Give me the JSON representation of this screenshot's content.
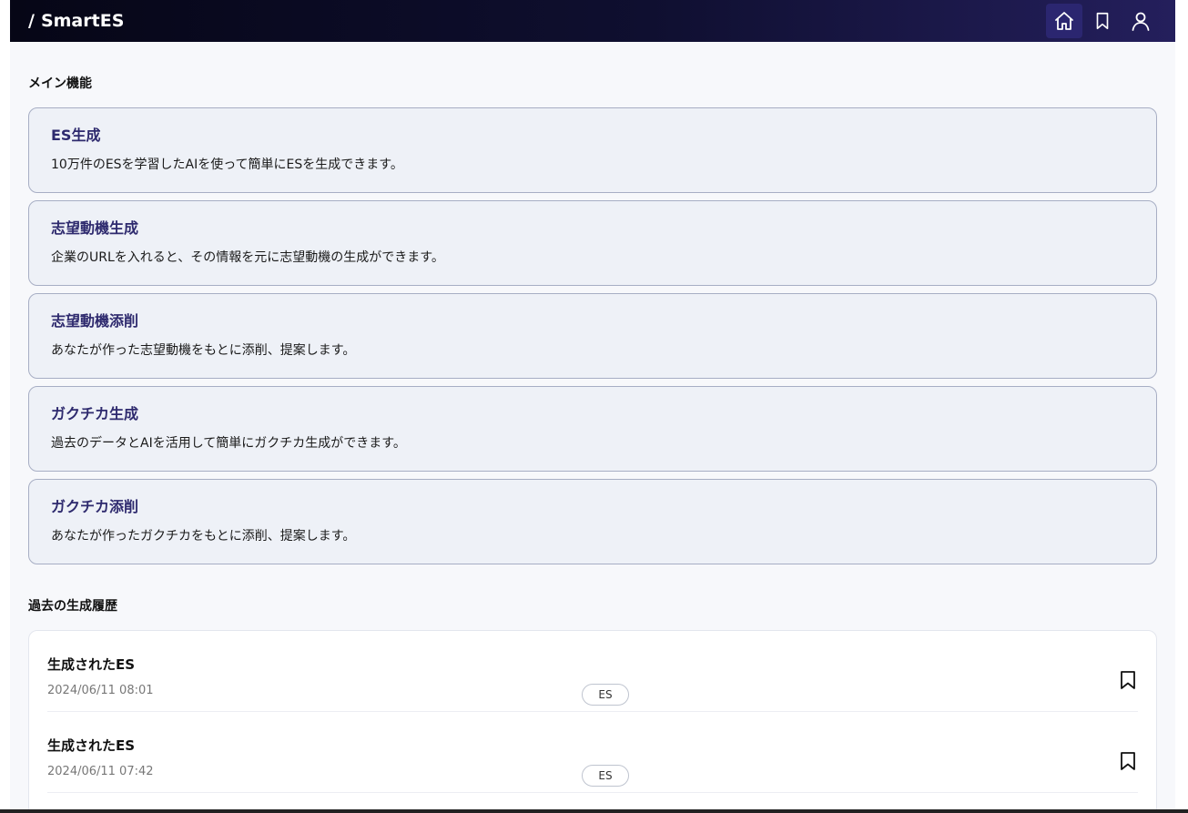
{
  "header": {
    "brand_slash": "/",
    "brand_name": "SmartES"
  },
  "nav": {
    "icons": [
      "home-icon",
      "bookmark-icon",
      "user-icon"
    ],
    "active": "home-icon"
  },
  "colors": {
    "accent": "#2e2a6e",
    "nav_active": "#2b2670",
    "card_bg": "#eef1f7",
    "card_border": "#a7aec4"
  },
  "main_features": {
    "title": "メイン機能",
    "items": [
      {
        "title": "ES生成",
        "description": "10万件のESを学習したAIを使って簡単にESを生成できます。"
      },
      {
        "title": "志望動機生成",
        "description": "企業のURLを入れると、その情報を元に志望動機の生成ができます。"
      },
      {
        "title": "志望動機添削",
        "description": "あなたが作った志望動機をもとに添削、提案します。"
      },
      {
        "title": "ガクチカ生成",
        "description": "過去のデータとAIを活用して簡単にガクチカ生成ができます。"
      },
      {
        "title": "ガクチカ添削",
        "description": "あなたが作ったガクチカをもとに添削、提案します。"
      }
    ]
  },
  "history": {
    "title": "過去の生成履歴",
    "items": [
      {
        "title": "生成されたES",
        "date": "2024/06/11 08:01",
        "tag": "ES"
      },
      {
        "title": "生成されたES",
        "date": "2024/06/11 07:42",
        "tag": "ES"
      }
    ]
  }
}
